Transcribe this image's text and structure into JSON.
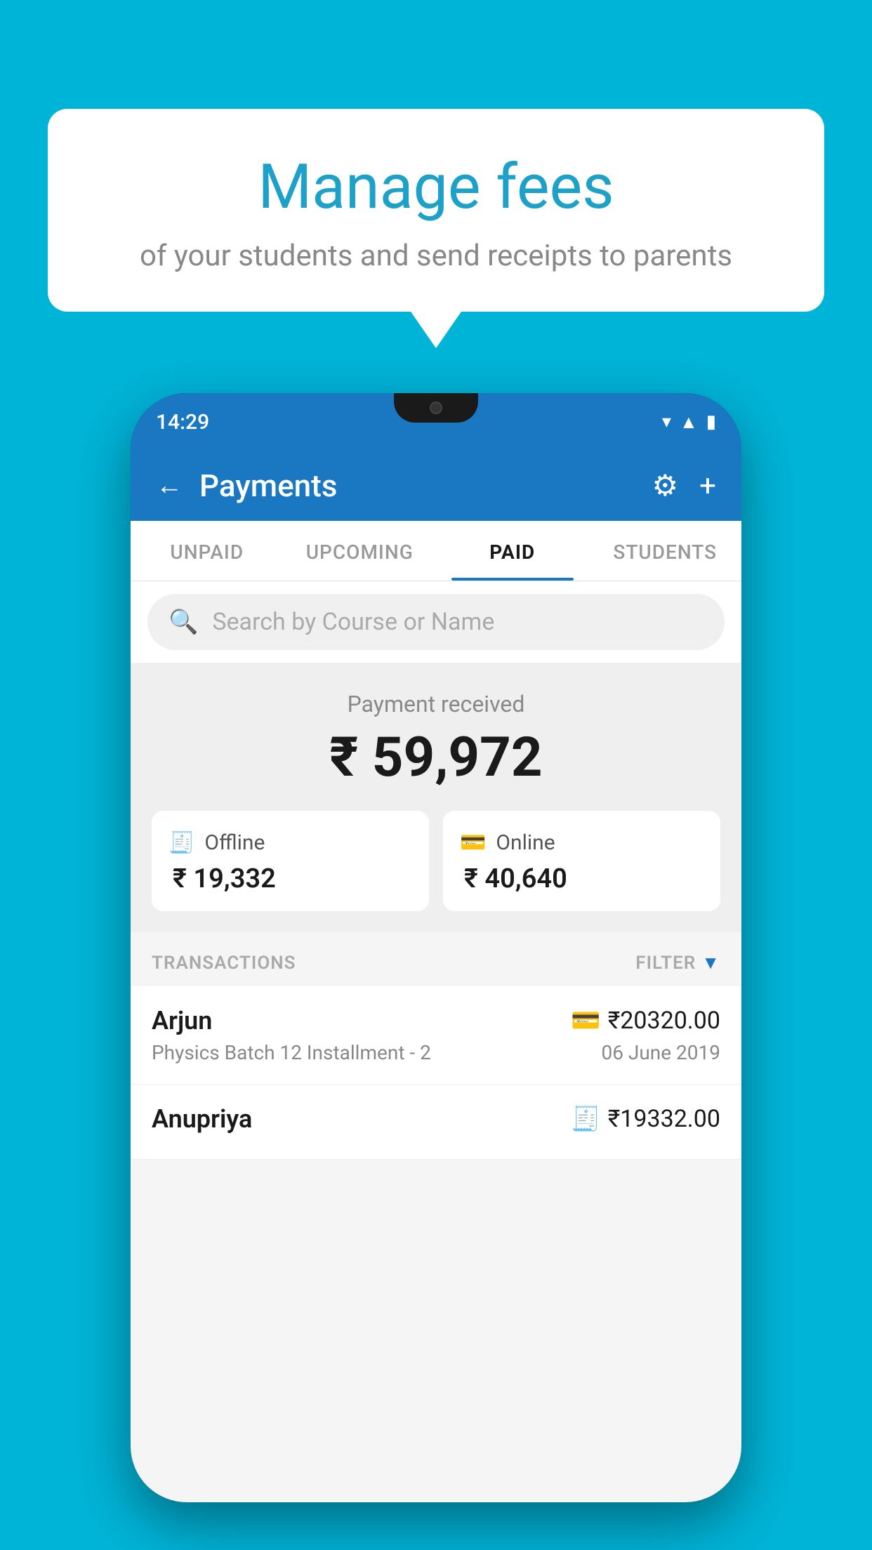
{
  "background_color": "#00b4d8",
  "bubble": {
    "title": "Manage fees",
    "subtitle": "of your students and send receipts to parents"
  },
  "phone": {
    "status_bar": {
      "time": "14:29"
    },
    "header": {
      "title": "Payments",
      "back_label": "←",
      "gear_label": "⚙",
      "plus_label": "+"
    },
    "tabs": [
      {
        "label": "UNPAID",
        "active": false
      },
      {
        "label": "UPCOMING",
        "active": false
      },
      {
        "label": "PAID",
        "active": true
      },
      {
        "label": "STUDENTS",
        "active": false
      }
    ],
    "search": {
      "placeholder": "Search by Course or Name"
    },
    "payment_received": {
      "label": "Payment received",
      "amount": "₹ 59,972",
      "offline": {
        "label": "Offline",
        "amount": "₹ 19,332"
      },
      "online": {
        "label": "Online",
        "amount": "₹ 40,640"
      }
    },
    "transactions": {
      "header": "TRANSACTIONS",
      "filter": "FILTER",
      "rows": [
        {
          "name": "Arjun",
          "amount": "₹20320.00",
          "description": "Physics Batch 12 Installment - 2",
          "date": "06 June 2019",
          "type": "online"
        },
        {
          "name": "Anupriya",
          "amount": "₹19332.00",
          "description": "",
          "date": "",
          "type": "offline"
        }
      ]
    }
  }
}
